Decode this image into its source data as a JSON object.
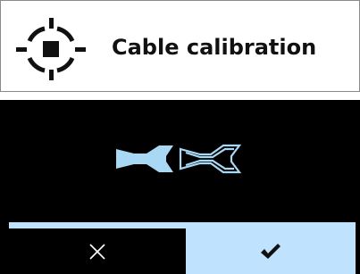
{
  "header": {
    "title": "Cable calibration",
    "icon": "calibration-target-icon"
  },
  "screen": {
    "illustration_icons": [
      "cable-connector-filled-icon",
      "cable-connector-outline-icon"
    ],
    "buttons": {
      "cancel_icon": "close-icon",
      "confirm_icon": "checkmark-icon"
    },
    "colors": {
      "accent": "#bfe3ff",
      "background": "#000000",
      "icon_dark": "#111111",
      "illustration": "#a9d8f5"
    }
  }
}
